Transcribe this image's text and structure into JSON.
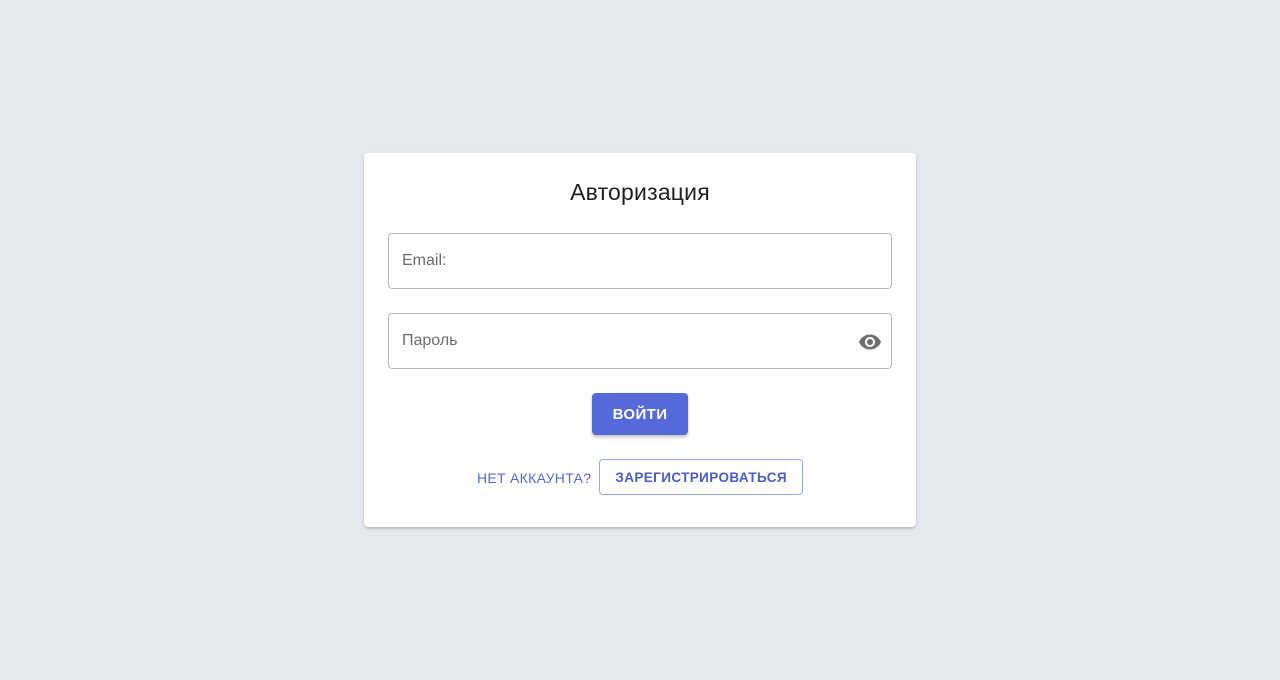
{
  "login_card": {
    "title": "Авторизация",
    "email_field": {
      "placeholder": "Email:",
      "value": ""
    },
    "password_field": {
      "placeholder": "Пароль",
      "value": "",
      "visibility_toggle_icon": "eye-icon"
    },
    "login_button_label": "ВОЙТИ",
    "no_account_text": "НЕТ АККАУНТА?",
    "register_button_label": "ЗАРЕГИСТРИРОВАТЬСЯ"
  },
  "colors": {
    "background": "#e6e9ee",
    "primary": "#5569d9",
    "card": "#ffffff"
  }
}
